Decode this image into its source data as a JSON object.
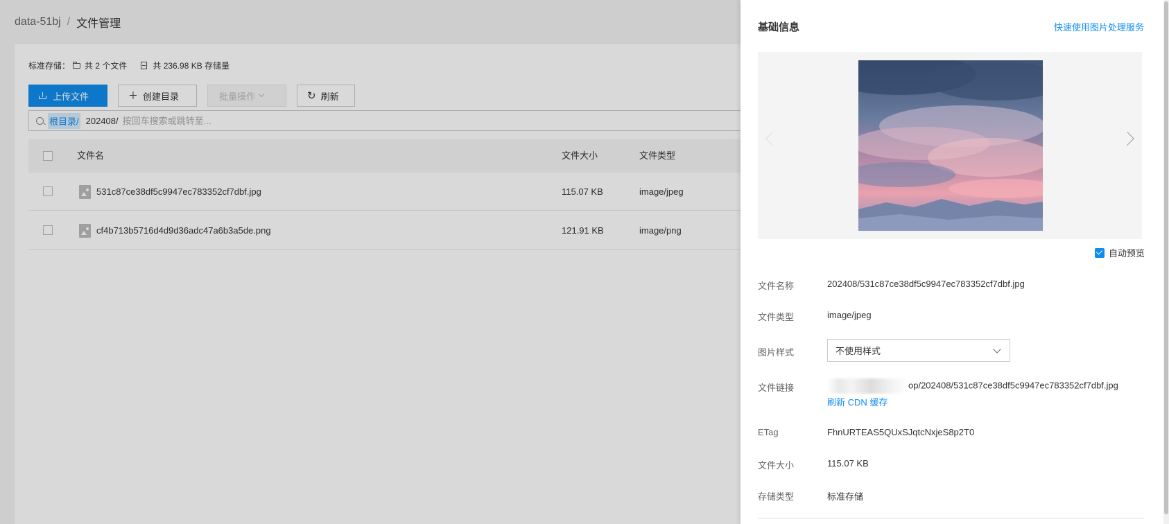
{
  "breadcrumb": {
    "bucket": "data-51bj",
    "separator": "/",
    "current": "文件管理"
  },
  "stats": {
    "storage_label": "标准存储：",
    "file_count": "共 2 个文件",
    "usage": "共 236.98 KB 存储量"
  },
  "toolbar": {
    "upload": "上传文件",
    "create_dir": "创建目录",
    "batch": "批量操作",
    "refresh": "刷新"
  },
  "search": {
    "root_tag": "根目录/",
    "path": "202408/",
    "placeholder": "按回车搜索或跳转至..."
  },
  "table": {
    "columns": {
      "name": "文件名",
      "size": "文件大小",
      "type": "文件类型"
    },
    "rows": [
      {
        "name": "531c87ce38df5c9947ec783352cf7dbf.jpg",
        "size": "115.07 KB",
        "type": "image/jpeg"
      },
      {
        "name": "cf4b713b5716d4d9d36adc47a6b3a5de.png",
        "size": "121.91 KB",
        "type": "image/png"
      }
    ]
  },
  "drawer": {
    "title": "基础信息",
    "image_service_link": "快速使用图片处理服务",
    "auto_preview": "自动预览",
    "auto_preview_checked": true,
    "fields": {
      "name_label": "文件名称",
      "name_value": "202408/531c87ce38df5c9947ec783352cf7dbf.jpg",
      "type_label": "文件类型",
      "type_value": "image/jpeg",
      "style_label": "图片样式",
      "style_value": "不使用样式",
      "link_label": "文件链接",
      "link_value": "op/202408/531c87ce38df5c9947ec783352cf7dbf.jpg",
      "refresh_cdn": "刷新 CDN 缓存",
      "etag_label": "ETag",
      "etag_value": "FhnURTEAS5QUxSJqtcNxjeS8p2T0",
      "size_label": "文件大小",
      "size_value": "115.07 KB",
      "storage_label": "存储类型",
      "storage_value": "标准存储"
    }
  },
  "colors": {
    "accent": "#108cee",
    "overlay": "rgba(0,0,0,0.15)"
  },
  "icons": [
    "upload-icon",
    "plus-icon",
    "chevron-down-icon",
    "refresh-icon",
    "search-icon",
    "folder-icon",
    "disk-icon",
    "image-file-icon",
    "chevron-left-icon",
    "chevron-right-icon",
    "checkbox-checked-icon"
  ]
}
